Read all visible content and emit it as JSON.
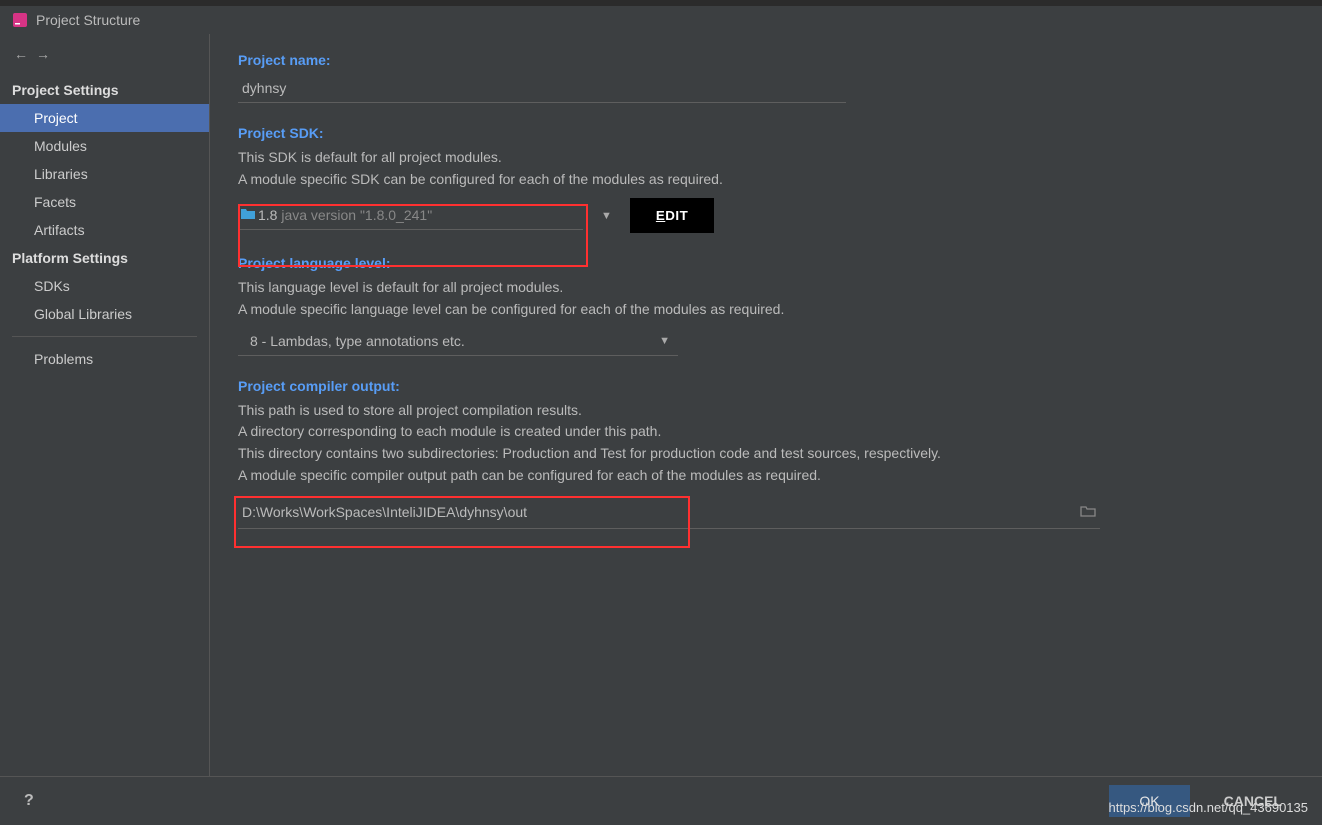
{
  "window": {
    "title": "Project Structure"
  },
  "sidebar": {
    "section_project": "Project Settings",
    "section_platform": "Platform Settings",
    "items_project": [
      "Project",
      "Modules",
      "Libraries",
      "Facets",
      "Artifacts"
    ],
    "items_platform": [
      "SDKs",
      "Global Libraries"
    ],
    "problems": "Problems"
  },
  "main": {
    "project_name_label": "Project name:",
    "project_name_value": "dyhnsy",
    "sdk_label": "Project SDK:",
    "sdk_desc1": "This SDK is default for all project modules.",
    "sdk_desc2": "A module specific SDK can be configured for each of the modules as required.",
    "sdk_value_primary": "1.8",
    "sdk_value_secondary": "java version \"1.8.0_241\"",
    "edit_accel": "E",
    "edit_rest": "DIT",
    "lang_label": "Project language level:",
    "lang_desc1": "This language level is default for all project modules.",
    "lang_desc2": "A module specific language level can be configured for each of the modules as required.",
    "lang_value": "8 - Lambdas, type annotations etc.",
    "out_label": "Project compiler output:",
    "out_desc1": "This path is used to store all project compilation results.",
    "out_desc2": "A directory corresponding to each module is created under this path.",
    "out_desc3": "This directory contains two subdirectories: Production and Test for production code and test sources, respectively.",
    "out_desc4": "A module specific compiler output path can be configured for each of the modules as required.",
    "out_value": "D:\\Works\\WorkSpaces\\InteliJIDEA\\dyhnsy\\out"
  },
  "footer": {
    "help": "?",
    "ok": "OK",
    "cancel": "CANCEL"
  },
  "watermark": "https://blog.csdn.net/qq_43690135"
}
